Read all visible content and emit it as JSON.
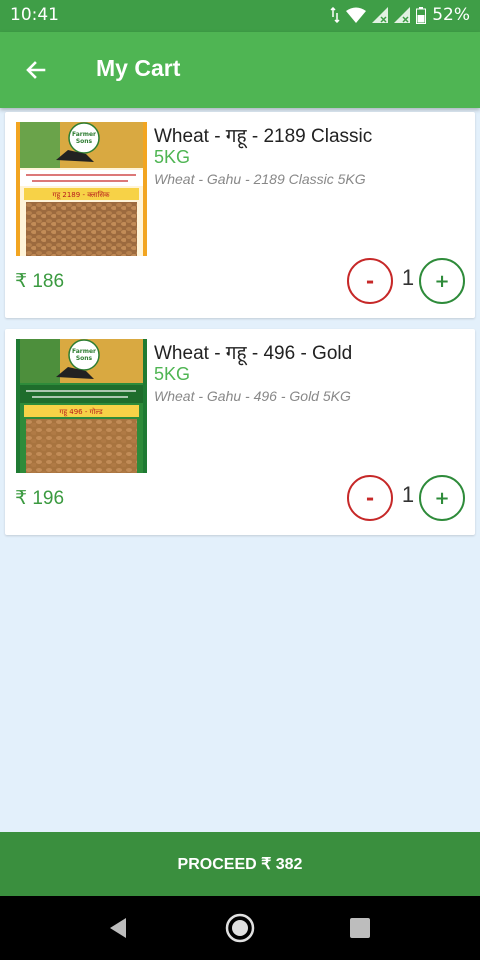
{
  "status": {
    "time": "10:41",
    "battery": "52%"
  },
  "appbar": {
    "title": "My Cart",
    "back_icon": "arrow-left-icon"
  },
  "cart": {
    "items": [
      {
        "name": "Wheat - गहू - 2189 Classic",
        "weight": "5KG",
        "subtitle": "Wheat - Gahu - 2189 Classic 5KG",
        "price": "₹ 186",
        "quantity": "1",
        "minus": "-",
        "plus": "+",
        "image_brand": "Farmer Sons",
        "image_label": "गहू 2189 - क्लासिक"
      },
      {
        "name": "Wheat - गहू - 496 - Gold",
        "weight": "5KG",
        "subtitle": "Wheat - Gahu - 496 - Gold 5KG",
        "price": "₹ 196",
        "quantity": "1",
        "minus": "-",
        "plus": "+",
        "image_brand": "Farmer Sons",
        "image_label": "गहू 496 - गोल्ड"
      }
    ]
  },
  "footer": {
    "proceed_label": "PROCEED ₹ 382"
  },
  "colors": {
    "primary": "#4fb553",
    "status_bar": "#3f9e47",
    "proceed": "#3a8f3e",
    "minus": "#c62828",
    "plus": "#2e8b3a",
    "background": "#e3f0fb"
  }
}
